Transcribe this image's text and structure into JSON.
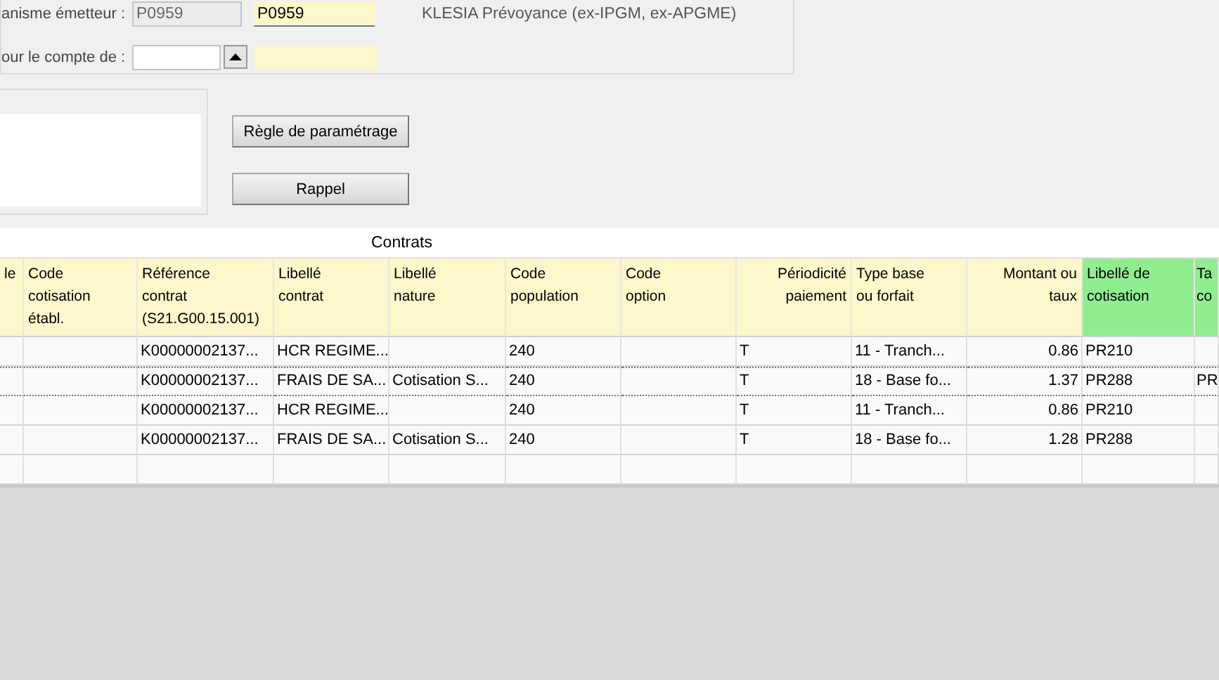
{
  "header_group": {
    "rows": [
      {
        "label": "anisme émetteur :",
        "fields": [
          {
            "kind": "readonly",
            "value": "P0959"
          },
          {
            "kind": "highlighted",
            "value": "P0959"
          }
        ],
        "description": "KLESIA Prévoyance (ex-IPGM, ex-APGME)"
      },
      {
        "label": "our le compte de :",
        "fields": [
          {
            "kind": "input"
          },
          {
            "kind": "spin"
          },
          {
            "kind": "highlighted"
          }
        ]
      }
    ]
  },
  "buttons": [
    {
      "label": "Règle de paramétrage"
    },
    {
      "label": "Rappel"
    }
  ],
  "table": {
    "title": "Contrats",
    "columns": [
      {
        "header": "le",
        "highlighted": false
      },
      {
        "header": "Code\ncotisation\nétabl.",
        "highlighted": false
      },
      {
        "header": "Référence\ncontrat\n(S21.G00.15.001)",
        "highlighted": false
      },
      {
        "header": "Libellé\ncontrat",
        "highlighted": false
      },
      {
        "header": "Libellé\nnature",
        "highlighted": false
      },
      {
        "header": "Code\npopulation",
        "highlighted": false
      },
      {
        "header": "Code\noption",
        "highlighted": false
      },
      {
        "header": "Périodicité\npaiement",
        "highlighted": false
      },
      {
        "header": "Type base\nou forfait",
        "highlighted": false
      },
      {
        "header": "Montant ou\ntaux",
        "highlighted": false
      },
      {
        "header": "Libellé de\ncotisation",
        "highlighted": true
      },
      {
        "header": "Ta\nco",
        "highlighted": true
      }
    ],
    "rows": [
      {
        "selected": false,
        "cells": [
          "",
          "",
          "K00000002137...",
          "HCR REGIME...",
          "",
          "240",
          "",
          "T",
          "11 - Tranch...",
          "0.86",
          "PR210",
          ""
        ]
      },
      {
        "selected": true,
        "cells": [
          "",
          "",
          "K00000002137...",
          "FRAIS DE SA...",
          "Cotisation S...",
          "240",
          "",
          "T",
          "18 - Base fo...",
          "1.37",
          "PR288",
          "PR"
        ]
      },
      {
        "selected": false,
        "cells": [
          "",
          "",
          "K00000002137...",
          "HCR REGIME...",
          "",
          "240",
          "",
          "T",
          "11 - Tranch...",
          "0.86",
          "PR210",
          ""
        ]
      },
      {
        "selected": false,
        "cells": [
          "",
          "",
          "K00000002137...",
          "FRAIS DE SA...",
          "Cotisation S...",
          "240",
          "",
          "T",
          "18 - Base fo...",
          "1.28",
          "PR288",
          ""
        ]
      },
      {
        "selected": false,
        "cells": [
          "",
          "",
          "",
          "",
          "",
          "",
          "",
          "",
          "",
          "",
          "",
          ""
        ]
      }
    ]
  }
}
